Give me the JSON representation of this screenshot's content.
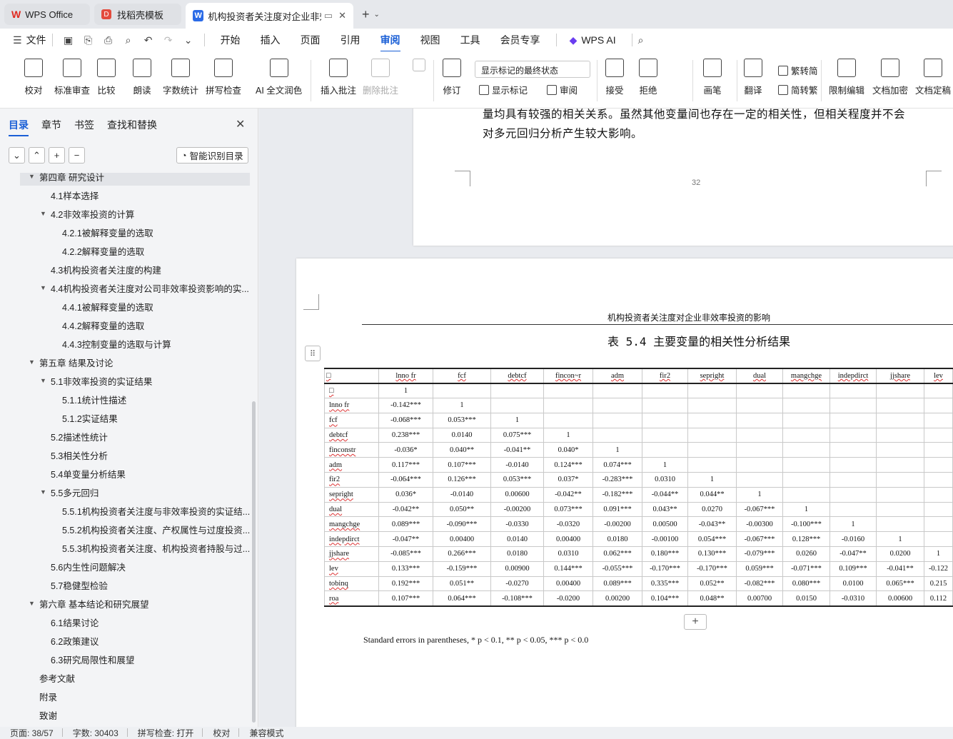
{
  "tabs": [
    {
      "label": "WPS Office"
    },
    {
      "label": "找稻壳模板"
    },
    {
      "label": "机构投资者关注度对企业非效率"
    }
  ],
  "menu": {
    "file": "文件",
    "items": [
      "开始",
      "插入",
      "页面",
      "引用",
      "审阅",
      "视图",
      "工具",
      "会员专享"
    ],
    "active": "审阅",
    "wps_ai": "WPS AI"
  },
  "ribbon": {
    "proofread": "校对",
    "std_review": "标准审查",
    "compare": "比较",
    "read_aloud": "朗读",
    "word_count": "字数统计",
    "spell_check": "拼写检查",
    "ai_polish": "AI 全文润色",
    "insert_comment": "插入批注",
    "delete_comment": "删除批注",
    "track": "修订",
    "markup_select": "显示标记的最终状态",
    "show_markup": "显示标记",
    "review": "审阅",
    "accept": "接受",
    "reject": "拒绝",
    "pen": "画笔",
    "translate": "翻译",
    "to_trad": "繁转简",
    "simp": "简转繁",
    "restrict": "限制编辑",
    "encrypt": "文档加密",
    "finalize": "文档定稿"
  },
  "sidebar": {
    "tabs": [
      "目录",
      "章节",
      "书签",
      "查找和替换"
    ],
    "active_tab": "目录",
    "smart_btn": "智能识别目录",
    "items": [
      {
        "label": "第四章 研究设计",
        "level": 1,
        "caret": true
      },
      {
        "label": "4.1样本选择",
        "level": 2
      },
      {
        "label": "4.2非效率投资的计算",
        "level": 2,
        "caret": true
      },
      {
        "label": "4.2.1被解释变量的选取",
        "level": 3
      },
      {
        "label": "4.2.2解释变量的选取",
        "level": 3
      },
      {
        "label": "4.3机构投资者关注度的构建",
        "level": 2
      },
      {
        "label": "4.4机构投资者关注度对公司非效率投资影响的实...",
        "level": 2,
        "caret": true
      },
      {
        "label": "4.4.1被解释变量的选取",
        "level": 3
      },
      {
        "label": "4.4.2解释变量的选取",
        "level": 3
      },
      {
        "label": "4.4.3控制变量的选取与计算",
        "level": 3
      },
      {
        "label": "第五章 结果及讨论",
        "level": 1,
        "caret": true
      },
      {
        "label": "5.1非效率投资的实证结果",
        "level": 2,
        "caret": true
      },
      {
        "label": "5.1.1统计性描述",
        "level": 3
      },
      {
        "label": "5.1.2实证结果",
        "level": 3
      },
      {
        "label": "5.2描述性统计",
        "level": 2
      },
      {
        "label": "5.3相关性分析",
        "level": 2
      },
      {
        "label": "5.4单变量分析结果",
        "level": 2
      },
      {
        "label": "5.5多元回归",
        "level": 2,
        "caret": true
      },
      {
        "label": "5.5.1机构投资者关注度与非效率投资的实证结...",
        "level": 3
      },
      {
        "label": "5.5.2机构投资者关注度、产权属性与过度投资...",
        "level": 3
      },
      {
        "label": "5.5.3机构投资者关注度、机构投资者持股与过...",
        "level": 3
      },
      {
        "label": "5.6内生性问题解决",
        "level": 2
      },
      {
        "label": "5.7稳健型检验",
        "level": 2
      },
      {
        "label": "第六章 基本结论和研究展望",
        "level": 1,
        "caret": true
      },
      {
        "label": "6.1结果讨论",
        "level": 2
      },
      {
        "label": "6.2政策建议",
        "level": 2
      },
      {
        "label": "6.3研究局限性和展望",
        "level": 2
      },
      {
        "label": "参考文献",
        "level": 1
      },
      {
        "label": "附录",
        "level": 1
      },
      {
        "label": "致谢",
        "level": 1
      }
    ]
  },
  "doc": {
    "prev_text_1": "量均具有较强的相关关系。虽然其他变量间也存在一定的相关性，但相关程度并不会",
    "prev_text_2": "对多元回归分析产生较大影响。",
    "page_number": "32",
    "running_header": "机构投资者关注度对企业非效率投资的影响",
    "table_caption": "表 5.4  主要变量的相关性分析结果",
    "note": "Standard errors in parentheses, * p < 0.1, ** p < 0.05, *** p < 0.0"
  },
  "table": {
    "headers": [
      "□",
      "lnno fr",
      "fcf",
      "debtcf",
      "fincon~r",
      "adm",
      "fir2",
      "sepright",
      "dual",
      "mangchge",
      "indepdirct",
      "jjshare",
      "lev"
    ],
    "rows": [
      [
        "□",
        "1",
        "",
        "",
        "",
        "",
        "",
        "",
        "",
        "",
        "",
        "",
        ""
      ],
      [
        "lnno fr",
        "-0.142***",
        "1",
        "",
        "",
        "",
        "",
        "",
        "",
        "",
        "",
        "",
        ""
      ],
      [
        "fcf",
        "-0.068***",
        "0.053***",
        "1",
        "",
        "",
        "",
        "",
        "",
        "",
        "",
        "",
        ""
      ],
      [
        "debtcf",
        "0.238***",
        "0.0140",
        "0.075***",
        "1",
        "",
        "",
        "",
        "",
        "",
        "",
        "",
        ""
      ],
      [
        "finconstr",
        "-0.036*",
        "0.040**",
        "-0.041**",
        "0.040*",
        "1",
        "",
        "",
        "",
        "",
        "",
        "",
        ""
      ],
      [
        "adm",
        "0.117***",
        "0.107***",
        "-0.0140",
        "0.124***",
        "0.074***",
        "1",
        "",
        "",
        "",
        "",
        "",
        ""
      ],
      [
        "fir2",
        "-0.064***",
        "0.126***",
        "0.053***",
        "0.037*",
        "-0.283***",
        "0.0310",
        "1",
        "",
        "",
        "",
        "",
        ""
      ],
      [
        "sepright",
        "0.036*",
        "-0.0140",
        "0.00600",
        "-0.042**",
        "-0.182***",
        "-0.044**",
        "0.044**",
        "1",
        "",
        "",
        "",
        ""
      ],
      [
        "dual",
        "-0.042**",
        "0.050**",
        "-0.00200",
        "0.073***",
        "0.091***",
        "0.043**",
        "0.0270",
        "-0.067***",
        "1",
        "",
        "",
        ""
      ],
      [
        "mangchge",
        "0.089***",
        "-0.090***",
        "-0.0330",
        "-0.0320",
        "-0.00200",
        "0.00500",
        "-0.043**",
        "-0.00300",
        "-0.100***",
        "1",
        "",
        ""
      ],
      [
        "indepdirct",
        "-0.047**",
        "0.00400",
        "0.0140",
        "0.00400",
        "0.0180",
        "-0.00100",
        "0.054***",
        "-0.067***",
        "0.128***",
        "-0.0160",
        "1",
        ""
      ],
      [
        "jjshare",
        "-0.085***",
        "0.266***",
        "0.0180",
        "0.0310",
        "0.062***",
        "0.180***",
        "0.130***",
        "-0.079***",
        "0.0260",
        "-0.047**",
        "0.0200",
        "1"
      ],
      [
        "lev",
        "0.133***",
        "-0.159***",
        "0.00900",
        "0.144***",
        "-0.055***",
        "-0.170***",
        "-0.170***",
        "0.059***",
        "-0.071***",
        "0.109***",
        "-0.041**",
        "-0.122"
      ],
      [
        "tobinq",
        "0.192***",
        "0.051**",
        "-0.0270",
        "0.00400",
        "0.089***",
        "0.335***",
        "0.052**",
        "-0.082***",
        "0.080***",
        "0.0100",
        "0.065***",
        "0.215"
      ],
      [
        "roa",
        "0.107***",
        "0.064***",
        "-0.108***",
        "-0.0200",
        "0.00200",
        "0.104***",
        "0.048**",
        "0.00700",
        "0.0150",
        "-0.0310",
        "0.00600",
        "0.112"
      ]
    ]
  },
  "status": {
    "page": "页面: 38/57",
    "words": "字数: 30403",
    "spell": "拼写检查: 打开",
    "proof": "校对",
    "compat": "兼容模式"
  }
}
